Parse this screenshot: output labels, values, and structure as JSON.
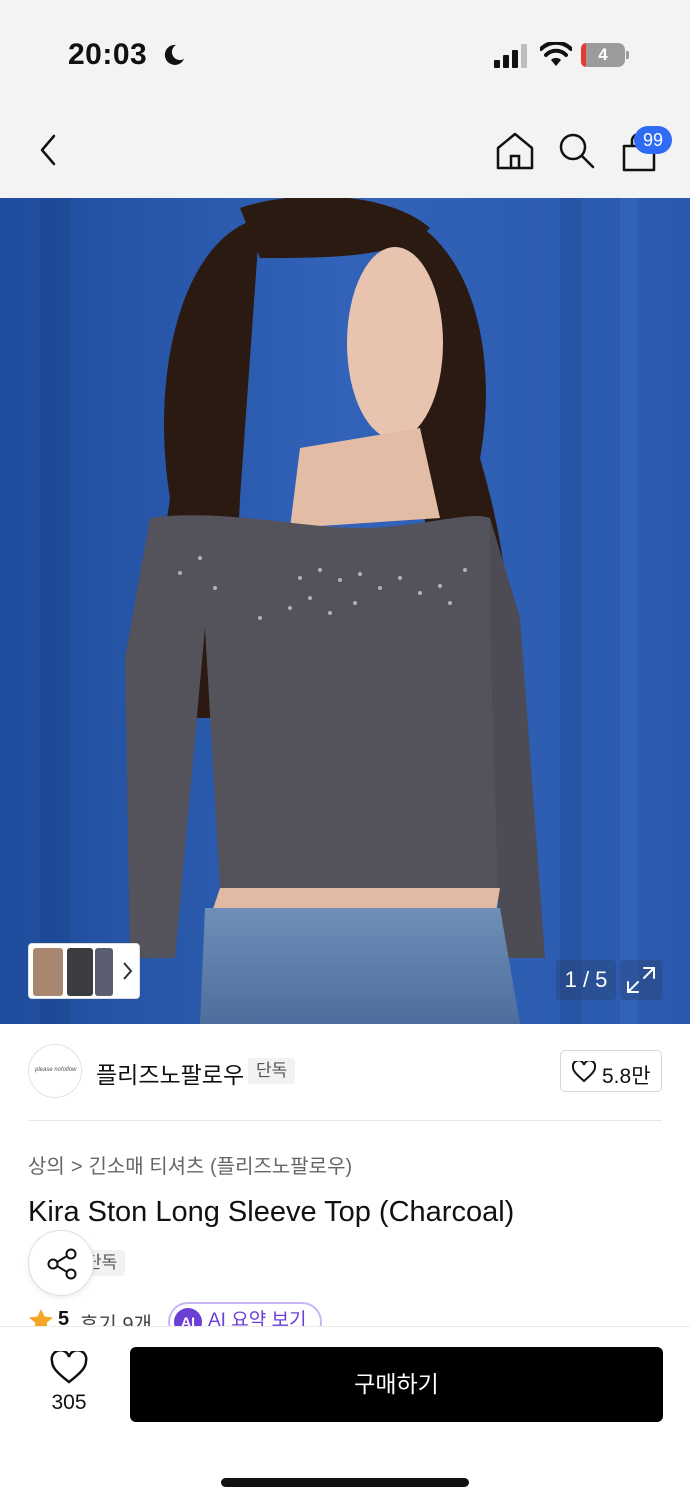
{
  "status_bar": {
    "time": "20:03",
    "battery_level": "4"
  },
  "nav": {
    "cart_count": "99",
    "icons": [
      "back-chevron-icon",
      "home-icon",
      "search-icon",
      "bag-icon"
    ]
  },
  "gallery": {
    "counter": "1 / 5"
  },
  "brand": {
    "logo_text": "please nofollow",
    "name": "플리즈노팔로우",
    "exclusive_label": "단독",
    "likes": "5.8만"
  },
  "product": {
    "breadcrumb_category": "상의",
    "breadcrumb_separator": ">",
    "breadcrumb_subcategory": "긴소매 티셔츠 (플리즈노팔로우)",
    "title": "Kira Ston Long Sleeve Top (Charcoal)",
    "tag": "단독",
    "rating": "5",
    "reviews": "후기 9개",
    "ai_badge": "AI",
    "ai_summary_label": "AI 요약 보기"
  },
  "bottom_bar": {
    "wishlist_count": "305",
    "buy_label": "구매하기"
  },
  "colors": {
    "accent_blue": "#2f6bf5",
    "ai_purple": "#6b3fd4",
    "buy_button": "#000000",
    "rating_star": "#f5a623"
  }
}
